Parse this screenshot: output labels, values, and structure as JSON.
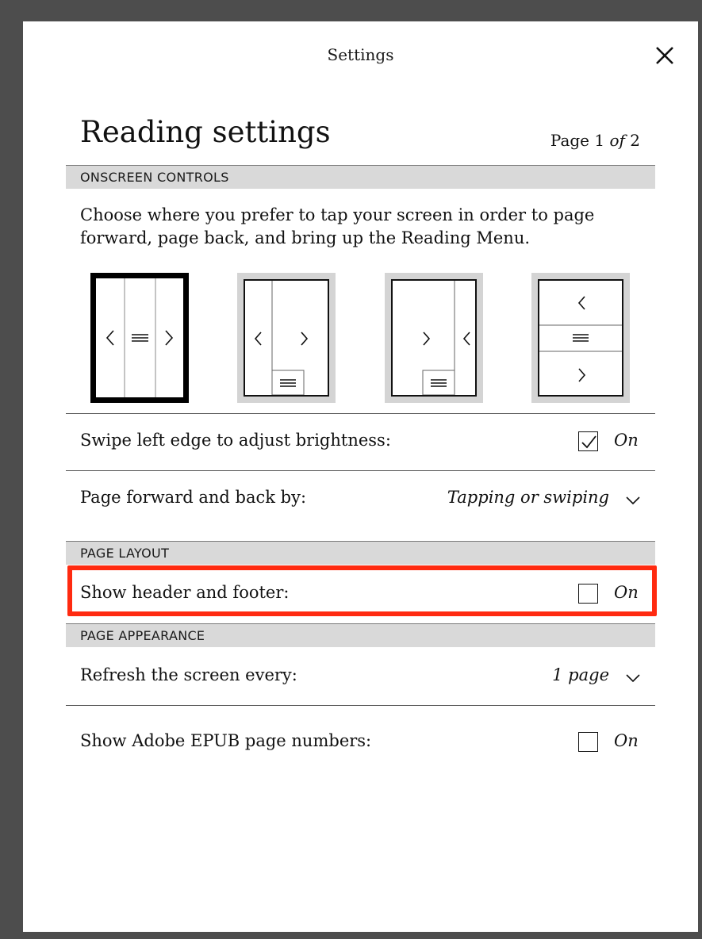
{
  "topbar": {
    "title": "Settings",
    "close_icon": "close-icon"
  },
  "header": {
    "title": "Reading settings",
    "page_prefix": "Page 1",
    "page_of": "of",
    "page_total": "2"
  },
  "sections": {
    "onscreen_controls": "ONSCREEN CONTROLS",
    "page_layout": "PAGE LAYOUT",
    "page_appearance": "PAGE APPEARANCE"
  },
  "onscreen": {
    "description": "Choose where you prefer to tap your screen in order to page forward, page back, and bring up the Reading Menu.",
    "options": [
      {
        "name": "three-columns",
        "selected": true
      },
      {
        "name": "two-columns-menu-bottom",
        "selected": false
      },
      {
        "name": "reversed-columns-menu-bottom",
        "selected": false
      },
      {
        "name": "three-rows",
        "selected": false
      }
    ]
  },
  "rows": {
    "swipe_brightness": {
      "label": "Swipe left edge to adjust brightness:",
      "state": "On",
      "checked": true
    },
    "page_forward": {
      "label": "Page forward and back by:",
      "value": "Tapping or swiping"
    },
    "header_footer": {
      "label": "Show header and footer:",
      "state": "On",
      "checked": false
    },
    "refresh": {
      "label": "Refresh the screen every:",
      "value": "1 page"
    },
    "adobe_numbers": {
      "label": "Show Adobe EPUB page numbers:",
      "state": "On",
      "checked": false
    }
  },
  "colors": {
    "highlight": "#ff2a10",
    "section_bg": "#d9d9d9",
    "option_bg": "#d4d4d4"
  }
}
